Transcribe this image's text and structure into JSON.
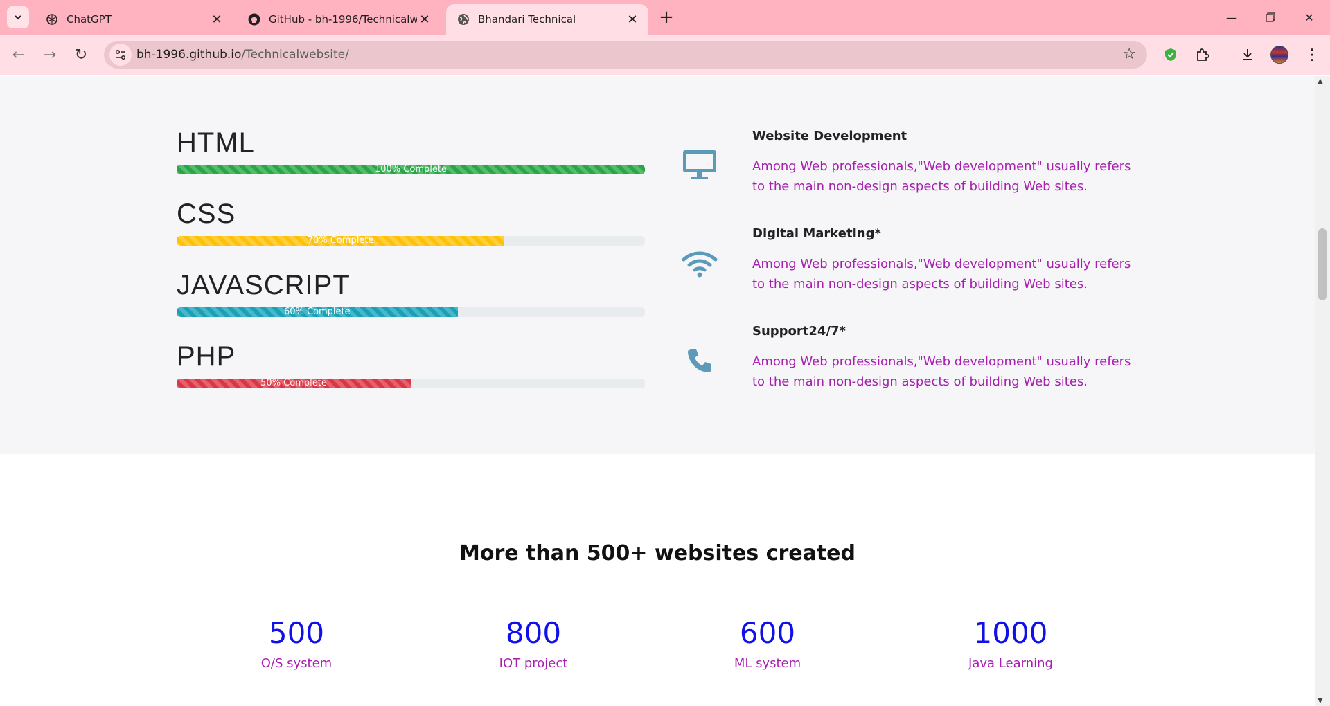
{
  "browser": {
    "tabs": [
      {
        "title": "ChatGPT",
        "icon": "chatgpt-icon"
      },
      {
        "title": "GitHub - bh-1996/Technicalwebsite",
        "icon": "github-icon"
      },
      {
        "title": "Bhandari Technical",
        "icon": "globe-icon"
      }
    ],
    "url_host": "bh-1996.github.io",
    "url_path": "/Technicalwebsite/",
    "theme_color": "#ffb2bf"
  },
  "skills": [
    {
      "name": "HTML",
      "label": "100% Complete",
      "percent": 100,
      "color": "#28a745"
    },
    {
      "name": "CSS",
      "label": "70% Complete",
      "percent": 70,
      "color": "#ffc107"
    },
    {
      "name": "JAVASCRIPT",
      "label": "60% Complete",
      "percent": 60,
      "color": "#17a2b8"
    },
    {
      "name": "PHP",
      "label": "50% Complete",
      "percent": 50,
      "color": "#dc3545"
    }
  ],
  "services": [
    {
      "title": "Website  Development",
      "text": "Among Web professionals,\"Web development\" usually refers to the main non-design aspects of building Web sites.",
      "icon": "desktop-icon"
    },
    {
      "title": "Digital  Marketing*",
      "text": "Among Web professionals,\"Web development\" usually refers to the main non-design aspects of building Web sites.",
      "icon": "wifi-icon"
    },
    {
      "title": "Support24/7*",
      "text": "Among Web professionals,\"Web development\" usually refers to the main non-design aspects of building Web sites.",
      "icon": "phone-icon"
    }
  ],
  "counters_heading": "More than 500+ websites created",
  "counters": [
    {
      "value": "500",
      "label": "O/S system"
    },
    {
      "value": "800",
      "label": "IOT project"
    },
    {
      "value": "600",
      "label": "ML system"
    },
    {
      "value": "1000",
      "label": "Java Learning"
    }
  ],
  "colors": {
    "service_icon": "#5b9ab8",
    "service_text": "#a81fb0",
    "counter_value": "#1010e8"
  }
}
